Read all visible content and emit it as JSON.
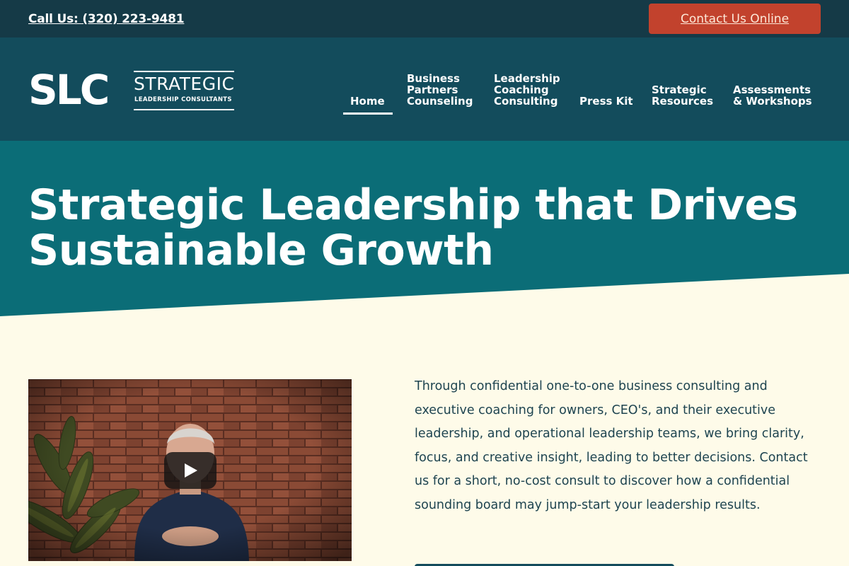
{
  "topbar": {
    "phone_label": "Call Us: (320) 223-9481",
    "contact_label": "Contact Us Online"
  },
  "logo": {
    "mark": "SLC",
    "word": "STRATEGIC",
    "sub": "LEADERSHIP CONSULTANTS"
  },
  "nav": {
    "home": [
      "Home"
    ],
    "business": [
      "Business",
      "Partners",
      "Counseling"
    ],
    "leadership": [
      "Leadership",
      "Coaching",
      "Consulting"
    ],
    "press": [
      "Press Kit"
    ],
    "strategic": [
      "Strategic",
      "Resources"
    ],
    "assessments": [
      "Assessments",
      "& Workshops"
    ]
  },
  "hero": {
    "title_line1": "Strategic Leadership that Drives",
    "title_line2": "Sustainable Growth"
  },
  "main": {
    "body": "Through confidential one-to-one business consulting and executive coaching for owners, CEO's, and their executive leadership, and operational leadership teams, we bring clarity, focus, and creative insight, leading to better decisions. Contact us for a short, no-cost consult to discover how a confidential sounding board may jump-start your leadership results."
  },
  "colors": {
    "topbar": "#153a47",
    "header": "#134c5c",
    "hero": "#0b6d77",
    "accent": "#c2422d",
    "page_bg": "#fefbe9",
    "text": "#1e4450"
  },
  "icons": {
    "play": "play-icon"
  }
}
